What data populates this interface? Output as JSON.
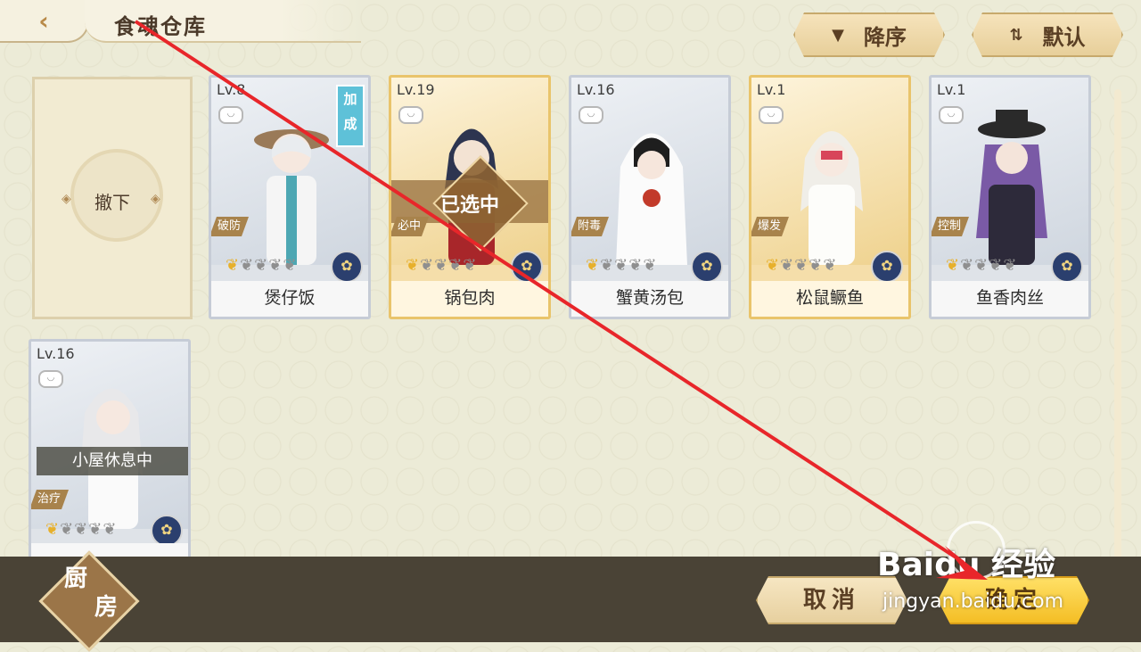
{
  "header": {
    "title": "食魂仓库",
    "back_icon": "back-arrow-icon"
  },
  "sort": {
    "order_label": "降序",
    "order_icon": "triangle-down-icon",
    "mode_label": "默认",
    "mode_icon": "swap-icon"
  },
  "unload": {
    "label": "撤下"
  },
  "cards": [
    {
      "level": "Lv.8",
      "name": "煲仔饭",
      "tag": "破防",
      "badge": "加成",
      "stars": 1,
      "max_stars": 5
    },
    {
      "level": "Lv.19",
      "name": "锅包肉",
      "tag": "必中",
      "status": "已选中",
      "stars": 1,
      "max_stars": 5
    },
    {
      "level": "Lv.16",
      "name": "蟹黄汤包",
      "tag": "附毒",
      "stars": 1,
      "max_stars": 5
    },
    {
      "level": "Lv.1",
      "name": "松鼠鳜鱼",
      "tag": "爆发",
      "stars": 1,
      "max_stars": 5
    },
    {
      "level": "Lv.1",
      "name": "鱼香肉丝",
      "tag": "控制",
      "stars": 1,
      "max_stars": 5
    },
    {
      "level": "Lv.16",
      "name": "",
      "tag": "治疗",
      "status": "小屋休息中",
      "stars": 1,
      "max_stars": 5
    }
  ],
  "footer": {
    "kitchen_l1": "厨",
    "kitchen_l2": "房",
    "cancel_label": "取消",
    "ok_label": "确定"
  },
  "watermark": {
    "main": "Baidu 经验",
    "sub": "jingyan.baidu.com"
  },
  "colors": {
    "accent": "#f4be25",
    "annotation_arrow": "#e8262a"
  }
}
